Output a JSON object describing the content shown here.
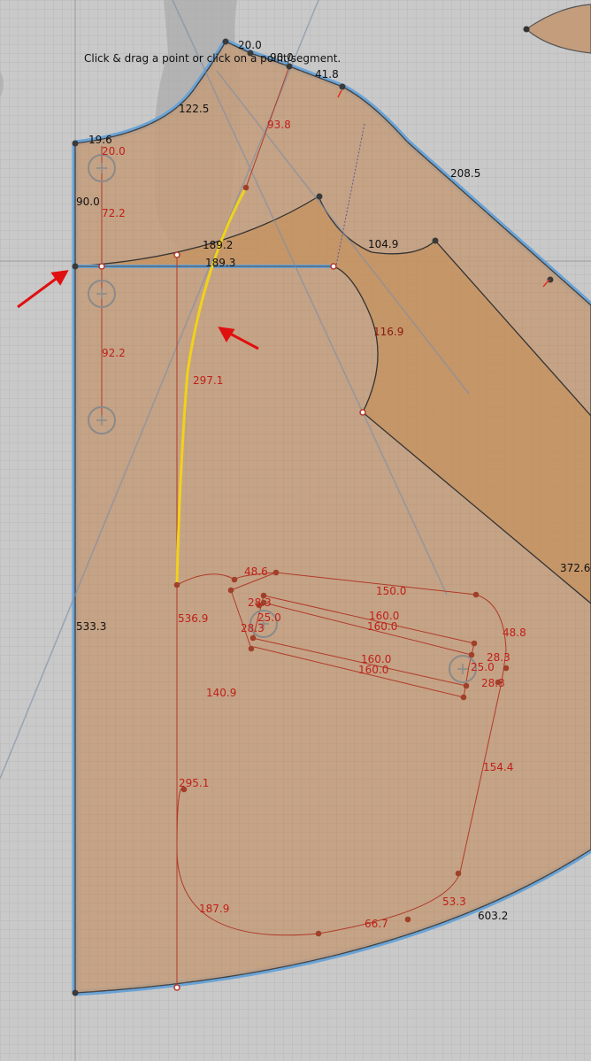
{
  "hint": "Click & drag a point or click on a point/segment.",
  "colors": {
    "background": "#c9c9c9",
    "piece_fill": "#c49d7c",
    "sleeve_fill": "#c4925e",
    "outline_blue": "#6aa3d6",
    "selected_seam": "#f0d21a",
    "pattern_red": "#b03a2a",
    "annotation_arrow": "#e01010"
  },
  "icons": [
    "crosshair-handle-icon",
    "red-arrow-pointer-icon"
  ],
  "labels": {
    "top_neck_20": "20.0",
    "top_90": "90.0",
    "shoulder_41_8": "41.8",
    "neck_curve": "122.5",
    "left_19_6": "19.6",
    "red_20": "20.0",
    "red_93_8": "93.8",
    "armhole_208_5": "208.5",
    "left_90": "90.0",
    "red_72_2": "72.2",
    "mid_189_2": "189.2",
    "mid_189_3": "189.3",
    "sleeve_104_9": "104.9",
    "sleeve_116_9": "116.9",
    "red_92_2": "92.2",
    "yellow_297_1": "297.1",
    "right_372_6": "372.6",
    "red_48_6": "48.6",
    "red_150": "150.0",
    "red_28_3_a": "28.3",
    "red_160_a": "160.0",
    "red_25_a": "25.0",
    "red_160_b": "160.0",
    "red_48_8": "48.8",
    "left_533_3": "533.3",
    "red_536_9": "536.9",
    "red_28_3_b": "28.3",
    "red_160_c": "160.0",
    "red_28_3_c": "28.3",
    "red_25_b": "25.0",
    "red_160_d": "160.0",
    "red_28_3_d": "28.3",
    "red_140_9": "140.9",
    "red_154_4": "154.4",
    "red_295_1": "295.1",
    "red_53_3": "53.3",
    "red_187_9": "187.9",
    "red_66_7": "66.7",
    "hem_603_2": "603.2"
  }
}
